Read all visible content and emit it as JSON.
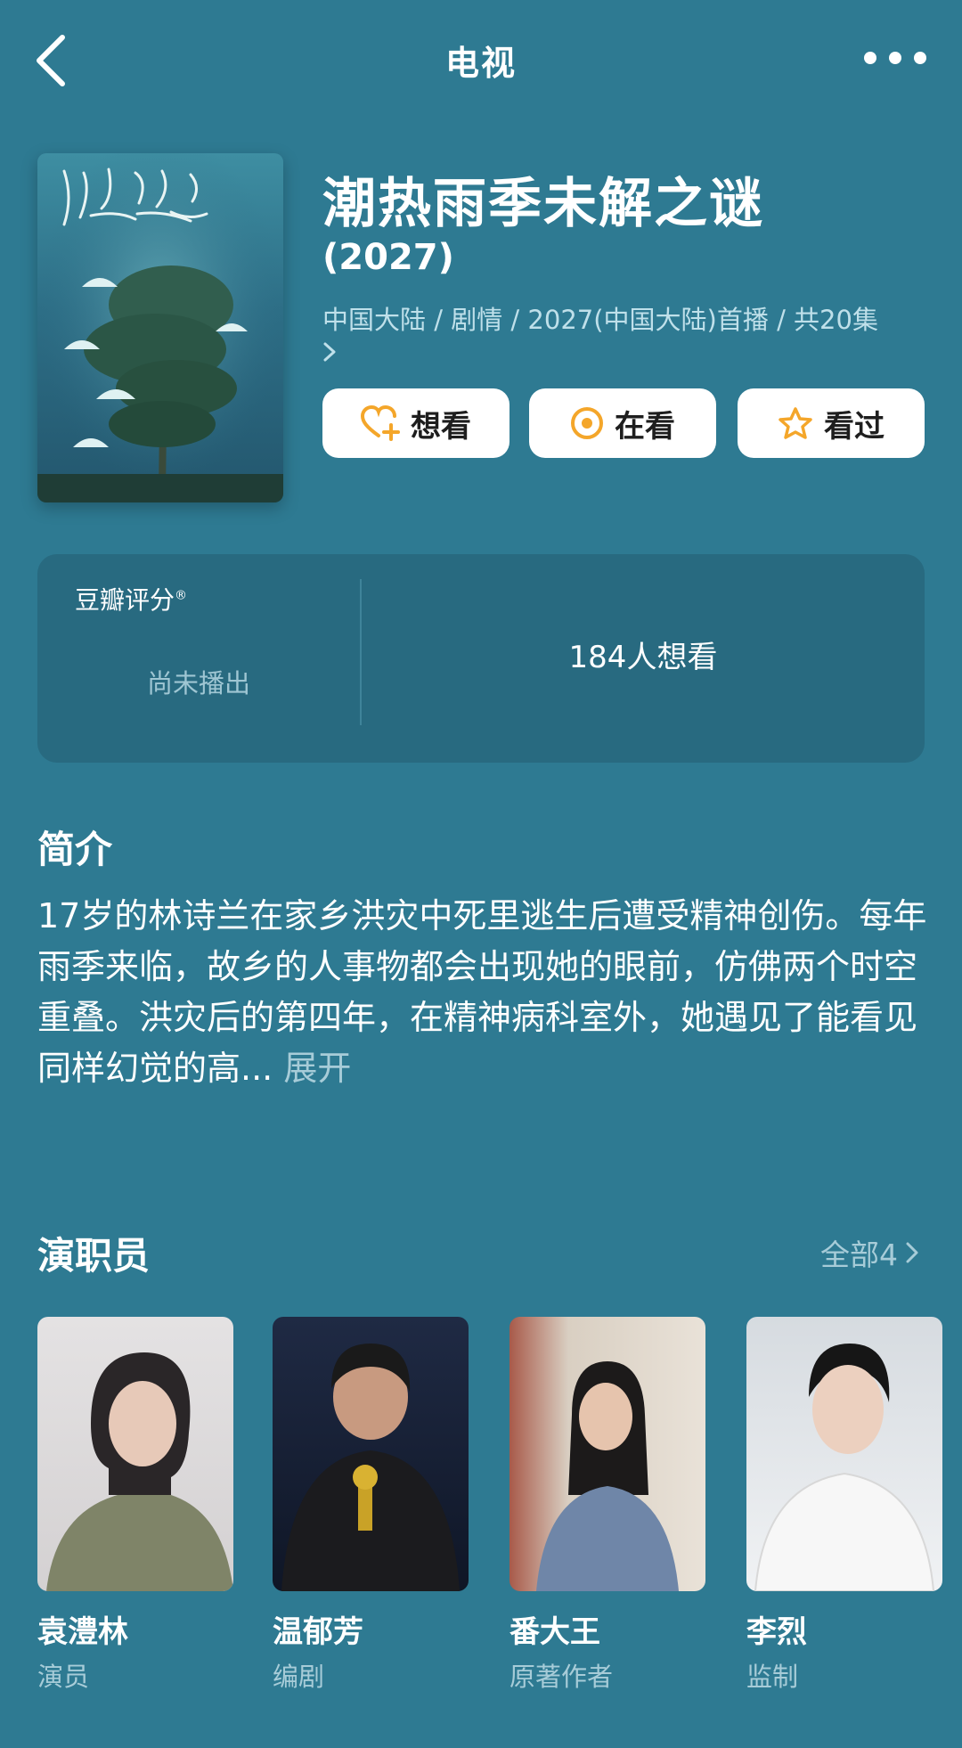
{
  "header": {
    "title": "电视"
  },
  "movie": {
    "title": "潮热雨季未解之谜",
    "year": "(2027)",
    "meta": "中国大陆 / 剧情 / 2027(中国大陆)首播 / 共20集"
  },
  "actions": {
    "want": "想看",
    "watching": "在看",
    "watched": "看过"
  },
  "rating": {
    "label": "豆瓣评分",
    "status": "尚未播出",
    "want_count": "184人想看"
  },
  "summary": {
    "title": "简介",
    "text": "17岁的林诗兰在家乡洪灾中死里逃生后遭受精神创伤。每年雨季来临，故乡的人事物都会出现她的眼前，仿佛两个时空重叠。洪灾后的第四年，在精神病科室外，她遇见了能看见同样幻觉的高...",
    "expand": "展开"
  },
  "cast": {
    "title": "演职员",
    "all_label": "全部4",
    "members": [
      {
        "name": "袁澧林",
        "role": "演员"
      },
      {
        "name": "温郁芳",
        "role": "编剧"
      },
      {
        "name": "番大王",
        "role": "原著作者"
      },
      {
        "name": "李烈",
        "role": "监制"
      }
    ]
  },
  "colors": {
    "background": "#2e7a92",
    "card": "#286a80",
    "accent": "#f4a62a",
    "muted_text": "#a7ccd8"
  }
}
